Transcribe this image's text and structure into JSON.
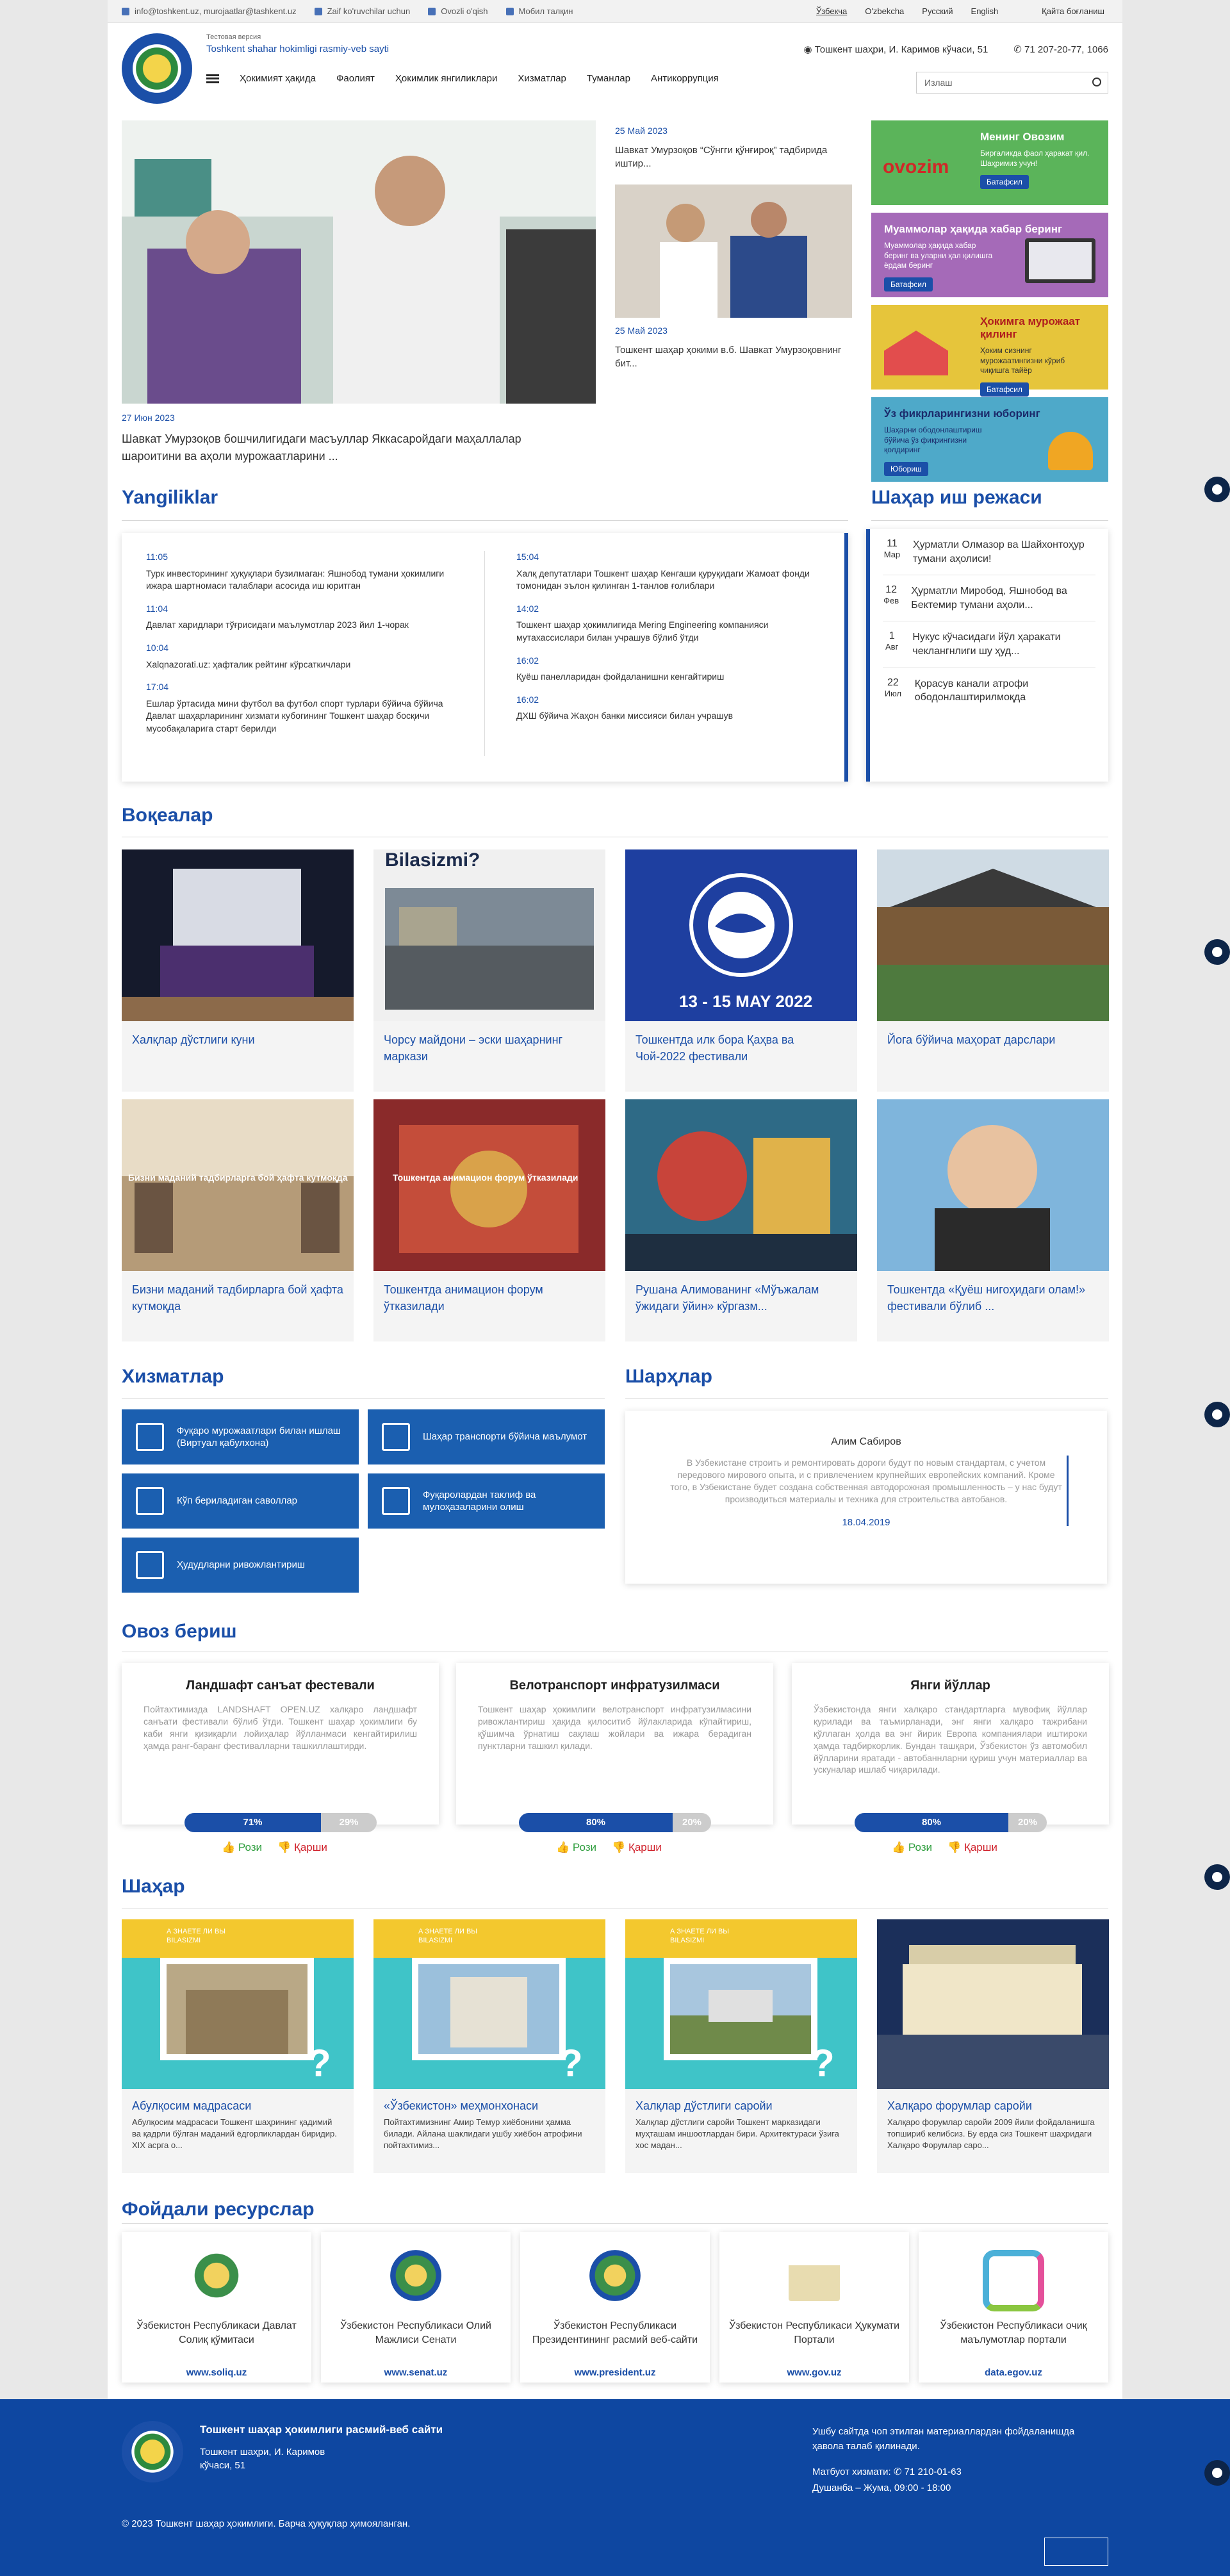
{
  "topbar": {
    "email": "info@toshkent.uz, murojaatlar@tashkent.uz",
    "disabled": "Zaif ko'ruvchilar uchun",
    "voice": "Ovozli o'qish",
    "mobile": "Мобил талқин",
    "lang_uz": "Ўзбекча",
    "lang_uzl": "O'zbekcha",
    "lang_ru": "Русский",
    "lang_en": "English",
    "login": "Қайта боғланиш"
  },
  "header": {
    "test_version": "Тестовая версия",
    "site_name": "Toshkent shahar hokimligi rasmiy-veb sayti",
    "address": "Тошкент шаҳри, И. Каримов кўчаси, 51",
    "phone": "71 207-20-77, 1066",
    "search_placeholder": "Излаш"
  },
  "nav": [
    "Ҳокимият ҳақида",
    "Фаолият",
    "Ҳокимлик янгиликлари",
    "Хизматлар",
    "Туманлар",
    "Антикоррупция"
  ],
  "hero": {
    "date": "27 Июн 2023",
    "text": "Шавкат Умурзоқов бошчилигидаги масъуллар Яккасаройдаги маҳаллалар шароитини ва аҳоли мурожаатларини ..."
  },
  "top_news": [
    {
      "date": "25 Май 2023",
      "text": "Шавкат Умурзоқов “Сўнгги қўнғироқ” тадбирида иштир..."
    },
    {
      "date": "25 Май 2023",
      "text": "Тошкент шаҳар ҳокими в.б. Шавкат Умурзоқовнинг бит..."
    }
  ],
  "side_cards": [
    {
      "title": "Менинг Овозим",
      "desc": "Биргаликда фаол ҳаракат қил. Шаҳримиз учун!",
      "btn": "Батафсил",
      "color": "#5bb45a",
      "logo": "ovozim"
    },
    {
      "title": "Муаммолар ҳақида хабар беринг",
      "desc": "Муаммолар ҳақида хабар беринг ва уларни ҳал қилишга ёрдам беринг",
      "btn": "Батафсил",
      "color": "#a56ab8"
    },
    {
      "title": "Ҳокимга мурожаат қилинг",
      "desc": "Ҳоким сизнинг мурожаатингизни кўриб чиқишга тайёр",
      "btn": "Батафсил",
      "color": "#e6c53b"
    },
    {
      "title": "Ўз фикрларингизни юборинг",
      "desc": "Шаҳарни ободонлаштириш бўйича ўз фикрингизни қолдиринг",
      "btn": "Юбориш",
      "color": "#4ea9c9"
    }
  ],
  "latest": {
    "title": "Yangiliklar",
    "left": [
      {
        "time": "11:05",
        "text": "Турк инвесторининг ҳуқуқлари бузилмаган: Яшнобод тумани ҳокимлиги ижара шартномаси талаблари асосида иш юритган"
      },
      {
        "time": "11:04",
        "text": "Давлат харидлари тўғрисидаги маълумотлар 2023 йил 1-чорак"
      },
      {
        "time": "10:04",
        "text": "Xalqnazorati.uz: ҳафталик рейтинг кўрсаткичлари"
      },
      {
        "time": "17:04",
        "text": "Ешлар ўртасида мини футбол ва футбол спорт турлари бўйича бўйича Давлат шаҳарларининг хизмати кубогининг Тошкент шаҳар босқичи мусобақаларига старт берилди"
      }
    ],
    "right": [
      {
        "time": "15:04",
        "text": "Халқ депутатлари Тошкент шаҳар Кенгаши қуруқидаги Жамоат фонди томонидан эълон қилинган 1-танлов ғолиблари"
      },
      {
        "time": "14:02",
        "text": "Тошкент шаҳар ҳокимлигида Mering Engineering компанияси мутахассислари билан учрашув бўлиб ўтди"
      },
      {
        "time": "16:02",
        "text": "Қуёш панелларидан фойдаланишни кенгайтириш"
      },
      {
        "time": "16:02",
        "text": "ДХШ бўйича Жаҳон банки миссияси билан учрашув"
      }
    ]
  },
  "schedule": {
    "title": "Шаҳар иш режаси",
    "items": [
      {
        "day": "11",
        "mon": "Мар",
        "text": "Ҳурматли Олмазор ва Шайхонтоҳур тумани аҳолиси!"
      },
      {
        "day": "12",
        "mon": "Фев",
        "text": "Ҳурматли Миробод, Яшнобод ва Бектемир тумани аҳоли..."
      },
      {
        "day": "1",
        "mon": "Авг",
        "text": "Нукус кўчасидаги йўл ҳаракати чеклангнлиги шу ҳуд..."
      },
      {
        "day": "22",
        "mon": "Июл",
        "text": "Қорасув канали атрофи ободонлаштирилмоқда"
      }
    ]
  },
  "events": {
    "title": "Воқеалар",
    "items": [
      "Халқлар дўстлиги куни",
      "Чорсу майдони – эски шаҳарнинг маркази",
      "Тошкентда илк бора Қаҳва ва Чой-2022 фестивали",
      "Йога бўйича маҳорат дарслари",
      "Бизни маданий тадбирларга бой ҳафта кутмоқда",
      "Тошкентда анимацион форум ўтказилади",
      "Рушана Алимованинг «Мўъжалам ўжидаги ўйин» кўргазм...",
      "Тошкентда «Қуёш нигоҳидаги олам!» фестивали бўлиб ..."
    ],
    "overlay_5": "Бизни маданий тадбирларга бой ҳафта кутмоқда",
    "overlay_6": "Тошкентда анимацион форум ўтказилади",
    "bilasizmi": "Bilasizmi?",
    "fest_date": "13 - 15 MAY 2022",
    "fest_ring": "TEA FESTCOFFEE & TEA FESTCOFFEE &"
  },
  "services": {
    "title": "Хизматлар",
    "items": [
      "Фуқаро мурожаатлари билан ишлаш (Виртуал қабулхона)",
      "Шаҳар транспорти бўйича маълумот",
      "Кўп бериладиган саволлар",
      "Фуқаролардан таклиф ва мулоҳазаларини олиш",
      "Ҳудудларни ривожлантириш"
    ]
  },
  "comments": {
    "title": "Шарҳлар",
    "author": "Алим Сабиров",
    "text": "В Узбекистане строить и ремонтировать дороги будут по новым стандартам, с учетом передового мирового опыта, и с привлечением крупнейших европейских компаний. Кроме того, в Узбекистане будет создана собственная автодорожная промышленность – у нас будут производиться материалы и техника для строительства автобанов.",
    "date": "18.04.2019"
  },
  "polls": {
    "title": "Овоз бериш",
    "items": [
      {
        "q": "Ландшафт санъат фестевали",
        "text": "Пойтахтимизда LANDSHAFT OPEN.UZ халқаро ландшафт санъати фестивали бўлиб ўтди. Тошкент шаҳар ҳокимлиги бу каби янги қизиқарли лойиҳалар йўлланмаси кенгайтирилиш ҳамда ранг-баранг фестивалларни ташкиллаштирди.",
        "yes": 71,
        "no": 29
      },
      {
        "q": "Велотранспорт инфратузилмаси",
        "text": "Тошкент шаҳар ҳокимлиги велотранспорт инфратузилмасини ривожлантириш ҳақида қилоситиб йўлакларида кўпайтириш, қўшимча ўрнатиш сақлаш жойлари ва ижара берадиган пунктларни ташкил қилади.",
        "yes": 80,
        "no": 20
      },
      {
        "q": "Янги йўллар",
        "text": "Ўзбекистонда янги халқаро стандартларга мувофиқ йўллар қурилади ва таъмирланади, энг янги халқаро тажрибани қўллаган ҳолда ва энг йирик Европа компаниялари иштироки ҳамда тадбиркорлик. Бундан ташқари, Ўзбекистон ўз автомобил йўлларини яратади - автобаннларни қуриш учун материаллар ва ускуналар ишлаб чиқарилади.",
        "yes": 80,
        "no": 20
      }
    ],
    "yes_label": "Рози",
    "no_label": "Қарши"
  },
  "city": {
    "title": "Шаҳар",
    "items": [
      {
        "name": "Абулқосим мадрасаси",
        "desc": "Абулқосим мадрасаси Тошкент шаҳрининг қадимий ва қадрли бўлган маданий ёдгорликлардан биридир. XIX асрга о..."
      },
      {
        "name": "«Ўзбекистон» меҳмонхонаси",
        "desc": "Пойтахтимизнинг Амир Темур хиёбонини ҳамма билади. Айлана шаклидаги ушбу хиёбон атрофини пойтахтимиз..."
      },
      {
        "name": "Халқлар дўстлиги саройи",
        "desc": "Халқлар дўстлиги саройи Тошкент марказидаги муҳташам иншоотлардан бири. Архитектураси ўзига хос мадан..."
      },
      {
        "name": "Халқаро форумлар саройи",
        "desc": "Халқаро форумлар саройи 2009 йили фойдаланишга топшириб келибсиз. Бу ерда сиз Тошкент шаҳридаги Халқаро Форумлар саро..."
      }
    ],
    "badge": "А ЗНАЕТЕ ЛИ ВЫ\nBILASIZMI"
  },
  "resources": {
    "title": "Фойдали ресурслар",
    "items": [
      {
        "name": "Ўзбекистон Республикаси Давлат Солиқ қўмитаси",
        "url": "www.soliq.uz"
      },
      {
        "name": "Ўзбекистон Республикаси Олий Мажлиси Сенати",
        "url": "www.senat.uz"
      },
      {
        "name": "Ўзбекистон Республикаси Президентининг расмий веб-сайти",
        "url": "www.president.uz"
      },
      {
        "name": "Ўзбекистон Республикаси Ҳукумати Портали",
        "url": "www.gov.uz"
      },
      {
        "name": "Ўзбекистон Республикаси очиқ маълумотлар портали",
        "url": "data.egov.uz"
      }
    ]
  },
  "footer": {
    "title": "Тошкент шаҳар ҳокимлиги расмий-веб сайти",
    "address": "Тошкент шаҳри, И. Каримов кўчаси, 51",
    "notice": "Ушбу сайтда чоп этилган материаллардан фойдаланишда ҳавола талаб қилинади.",
    "press_label": "Матбуот хизмати:",
    "press_phone": "71 210-01-63",
    "hours": "Душанба – Жума, 09:00 - 18:00",
    "copyright": "© 2023 Тошкент шаҳар ҳокимлиги. Барча ҳуқуқлар ҳимояланган."
  }
}
